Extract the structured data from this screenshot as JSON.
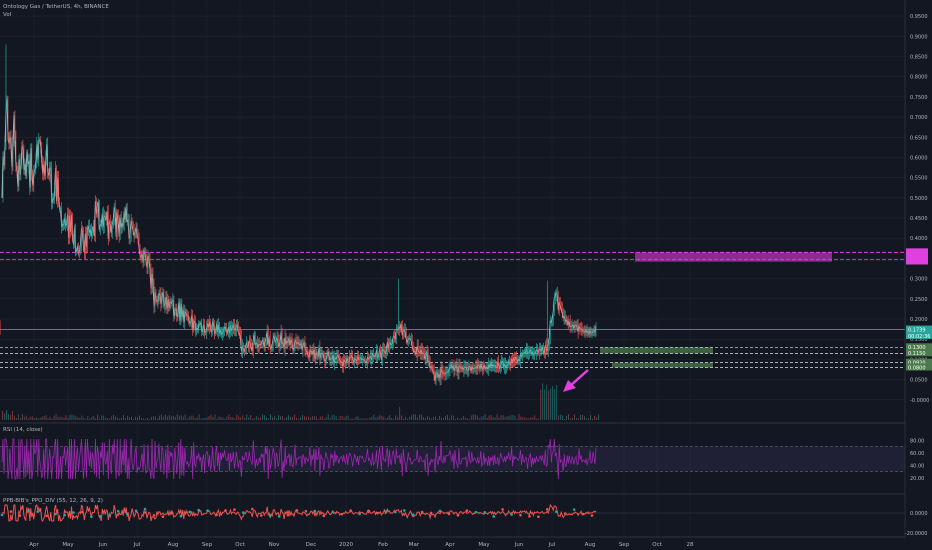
{
  "header": {
    "symbol_line": "Ontology Gas / TetherUS, 4h, BINANCE",
    "vol_label": "Vol"
  },
  "chart_data": {
    "type": "line",
    "title": "Ontology Gas / TetherUS, 4h, BINANCE",
    "xlabel": "",
    "ylabel": "",
    "x_ticks": [
      "Apr",
      "May",
      "Jun",
      "Jul",
      "Aug",
      "Sep",
      "Oct",
      "Nov",
      "Dec",
      "2020",
      "Feb",
      "Mar",
      "Apr",
      "May",
      "Jun",
      "Jul",
      "Aug",
      "Sep",
      "Oct",
      "28"
    ],
    "ylim": [
      -0.05,
      0.975
    ],
    "y_ticks": [
      "0.9500",
      "0.9000",
      "0.8500",
      "0.8000",
      "0.7500",
      "0.7000",
      "0.6500",
      "0.6000",
      "0.5500",
      "0.5000",
      "0.4500",
      "0.4000",
      "0.3500",
      "0.3000",
      "0.2500",
      "0.2000",
      "0.1500",
      "0.1000",
      "0.0500",
      "-0.0000"
    ],
    "price_series": {
      "name": "",
      "x": [
        0,
        1,
        2,
        3,
        4,
        5,
        6,
        7,
        8,
        9,
        10,
        11,
        12,
        13,
        14,
        15,
        16,
        17,
        18,
        19,
        20,
        21,
        22,
        23,
        24,
        25,
        26,
        27,
        28,
        29,
        30,
        31,
        32,
        33,
        34,
        35,
        36,
        37,
        38,
        39,
        40,
        41,
        42,
        43,
        44,
        45,
        46,
        47,
        48,
        49,
        50,
        51,
        52,
        53,
        54,
        55,
        56,
        57,
        58,
        59,
        60,
        61,
        62,
        63,
        64,
        65,
        66,
        67,
        68,
        69,
        70,
        71,
        72,
        73,
        74,
        75,
        76,
        77,
        78,
        79,
        80,
        81,
        82,
        83,
        84,
        85,
        86,
        87,
        88,
        89,
        90,
        91,
        92,
        93,
        94,
        95,
        96,
        97,
        98,
        99,
        100,
        101,
        102,
        103,
        104,
        105,
        106,
        107,
        108,
        109,
        110,
        111,
        112,
        113,
        114,
        115,
        116,
        117,
        118,
        119,
        120,
        121,
        122,
        123,
        124,
        125,
        126,
        127,
        128,
        129,
        130,
        131,
        132,
        133,
        134,
        135,
        136,
        137,
        138,
        139,
        140,
        141,
        142,
        143,
        144,
        145,
        146,
        147,
        148,
        149,
        150,
        151,
        152,
        153,
        154,
        155,
        156,
        157,
        158,
        159,
        160,
        161,
        162,
        163,
        164,
        165,
        166,
        167,
        168,
        169,
        170,
        171,
        172,
        173,
        174,
        175,
        176,
        177,
        178,
        179,
        180,
        181,
        182,
        183,
        184,
        185,
        186,
        187,
        188,
        189,
        190,
        191,
        192,
        193,
        194,
        195,
        196,
        197,
        198,
        199,
        200,
        201,
        202,
        203,
        204,
        205,
        206,
        207,
        208,
        209,
        210,
        211,
        212,
        213,
        214,
        215,
        216,
        217,
        218,
        219,
        220,
        221,
        222,
        223,
        224,
        225,
        226,
        227,
        228,
        229,
        230,
        231,
        232,
        233,
        234,
        235,
        236,
        237,
        238,
        239,
        240,
        241,
        242,
        243,
        244,
        245,
        246,
        247,
        248,
        249,
        250,
        251,
        252,
        253,
        254,
        255,
        256,
        257,
        258,
        259,
        260,
        261,
        262,
        263,
        264,
        265,
        266,
        267,
        268,
        269,
        270,
        271,
        272,
        273,
        274,
        275,
        276,
        277,
        278,
        279,
        280,
        281,
        282,
        283,
        284,
        285,
        286,
        287,
        288,
        289,
        290,
        291,
        292,
        293,
        294,
        295,
        296,
        297,
        298,
        299,
        300,
        301,
        302,
        303,
        304,
        305,
        306,
        307,
        308,
        309,
        310,
        311,
        312,
        313,
        314,
        315,
        316,
        317,
        318,
        319,
        320,
        321,
        322,
        323,
        324,
        325,
        326,
        327,
        328,
        329,
        330,
        331,
        332,
        333,
        334,
        335,
        336,
        337,
        338,
        339,
        340,
        341,
        342,
        343,
        344,
        345,
        346,
        347,
        348,
        349,
        350,
        351,
        352,
        353,
        354,
        355,
        356,
        357,
        358,
        359,
        360,
        361,
        362,
        363,
        364,
        365,
        366,
        367,
        368,
        369,
        370,
        371,
        372,
        373,
        374,
        375,
        376,
        377,
        378,
        379,
        380,
        381,
        382,
        383,
        384,
        385,
        386,
        387,
        388,
        389,
        390,
        391,
        392,
        393,
        394,
        395,
        396,
        397,
        398,
        399,
        400,
        401,
        402,
        403,
        404,
        405,
        406,
        407,
        408,
        409,
        410,
        411,
        412,
        413,
        414,
        415,
        416,
        417,
        418,
        419,
        420,
        421,
        422,
        423,
        424,
        425,
        426,
        427,
        428,
        429,
        430,
        431,
        432,
        433,
        434,
        435,
        436,
        437,
        438,
        439,
        440,
        441,
        442,
        443,
        444,
        445,
        446,
        447,
        448,
        449,
        450,
        451,
        452,
        453,
        454,
        455,
        456,
        457,
        458,
        459,
        460,
        461,
        462,
        463,
        464,
        465,
        466,
        467,
        468,
        469,
        470,
        471,
        472,
        473,
        474,
        475,
        476,
        477,
        478,
        479,
        480,
        481,
        482,
        483,
        484,
        485,
        486,
        487,
        488,
        489,
        490,
        491,
        492,
        493,
        494,
        495,
        496,
        497,
        498,
        499,
        500,
        501,
        502,
        503,
        504,
        505,
        506,
        507,
        508,
        509,
        510,
        511,
        512,
        513,
        514,
        515,
        516,
        517,
        518,
        519,
        520,
        521,
        522,
        523,
        524,
        525,
        526,
        527,
        528,
        529,
        530,
        531,
        532,
        533,
        534,
        535,
        536,
        537,
        538,
        539,
        540,
        541,
        542,
        543,
        544,
        545,
        546,
        547,
        548,
        549,
        550,
        551,
        552,
        553,
        554,
        555,
        556,
        557,
        558,
        559,
        560,
        561,
        562,
        563,
        564,
        565,
        566,
        567,
        568,
        569,
        570,
        571,
        572,
        573,
        574,
        575,
        576,
        577,
        578,
        579,
        580,
        581,
        582,
        583,
        584,
        585,
        586,
        587,
        588,
        589,
        590,
        591,
        592,
        593,
        594,
        595,
        596,
        597,
        598
      ],
      "values": [
        0.5,
        0.603,
        0.58,
        0.63,
        0.718,
        0.746,
        0.647,
        0.634,
        0.652,
        0.632,
        0.576,
        0.635,
        0.705,
        0.652,
        0.579,
        0.567,
        0.527,
        0.596,
        0.558,
        0.582,
        0.628,
        0.621,
        0.568,
        0.585,
        0.553,
        0.613,
        0.583,
        0.592,
        0.525,
        0.624,
        0.556,
        0.53,
        0.565,
        0.571,
        0.591,
        0.633,
        0.595,
        0.643,
        0.643,
        0.628,
        0.589,
        0.56,
        0.583,
        0.555,
        0.594,
        0.633,
        0.564,
        0.555,
        0.574,
        0.574,
        0.487,
        0.498,
        0.497,
        0.52,
        0.574,
        0.491,
        0.551,
        0.493,
        0.473,
        0.473,
        0.428,
        0.434,
        0.433,
        0.449,
        0.432,
        0.435,
        0.459,
        0.401,
        0.456,
        0.416,
        0.457,
        0.399,
        0.384,
        0.426,
        0.366,
        0.368,
        0.381,
        0.363,
        0.369,
        0.384,
        0.425,
        0.416,
        0.377,
        0.366,
        0.412,
        0.378,
        0.42,
        0.43,
        0.415,
        0.422,
        0.406,
        0.423,
        0.429,
        0.405,
        0.492,
        0.46,
        0.482,
        0.489,
        0.421,
        0.433,
        0.432,
        0.461,
        0.428,
        0.455,
        0.453,
        0.445,
        0.467,
        0.398,
        0.441,
        0.434,
        0.412,
        0.434,
        0.44,
        0.478,
        0.466,
        0.403,
        0.464,
        0.442,
        0.404,
        0.451,
        0.426,
        0.438,
        0.428,
        0.467,
        0.446,
        0.479,
        0.44,
        0.446,
        0.399,
        0.407,
        0.444,
        0.432,
        0.419,
        0.406,
        0.413,
        0.428,
        0.408,
        0.4,
        0.375,
        0.358,
        0.352,
        0.361,
        0.339,
        0.368,
        0.363,
        0.344,
        0.327,
        0.356,
        0.346,
        0.321,
        0.276,
        0.312,
        0.283,
        0.231,
        0.266,
        0.246,
        0.244,
        0.244,
        0.264,
        0.26,
        0.237,
        0.257,
        0.267,
        0.232,
        0.237,
        0.255,
        0.226,
        0.249,
        0.227,
        0.242,
        0.239,
        0.244,
        0.246,
        0.206,
        0.222,
        0.225,
        0.205,
        0.214,
        0.242,
        0.195,
        0.238,
        0.205,
        0.223,
        0.192,
        0.218,
        0.213,
        0.208,
        0.208,
        0.196,
        0.19,
        0.191,
        0.209,
        0.172,
        0.195,
        0.191,
        0.172,
        0.178,
        0.173,
        0.188,
        0.186,
        0.19,
        0.168,
        0.174,
        0.186,
        0.166,
        0.168,
        0.178,
        0.189,
        0.18,
        0.192,
        0.175,
        0.167,
        0.194,
        0.184,
        0.164,
        0.168,
        0.188,
        0.168,
        0.186,
        0.165,
        0.171,
        0.162,
        0.165,
        0.17,
        0.179,
        0.179,
        0.169,
        0.167,
        0.18,
        0.165,
        0.184,
        0.171,
        0.178,
        0.185,
        0.174,
        0.172,
        0.183,
        0.185,
        0.168,
        0.165,
        0.158,
        0.121,
        0.132,
        0.124,
        0.12,
        0.128,
        0.141,
        0.135,
        0.13,
        0.145,
        0.14,
        0.13,
        0.121,
        0.148,
        0.16,
        0.136,
        0.141,
        0.137,
        0.131,
        0.138,
        0.136,
        0.138,
        0.144,
        0.148,
        0.127,
        0.144,
        0.152,
        0.17,
        0.136,
        0.153,
        0.131,
        0.126,
        0.134,
        0.152,
        0.159,
        0.142,
        0.146,
        0.153,
        0.144,
        0.13,
        0.141,
        0.169,
        0.14,
        0.142,
        0.126,
        0.155,
        0.137,
        0.145,
        0.142,
        0.152,
        0.136,
        0.149,
        0.142,
        0.123,
        0.127,
        0.148,
        0.143,
        0.139,
        0.142,
        0.139,
        0.135,
        0.141,
        0.123,
        0.136,
        0.141,
        0.126,
        0.121,
        0.119,
        0.109,
        0.106,
        0.124,
        0.117,
        0.12,
        0.112,
        0.124,
        0.101,
        0.116,
        0.11,
        0.108,
        0.129,
        0.104,
        0.115,
        0.113,
        0.114,
        0.102,
        0.095,
        0.1,
        0.11,
        0.119,
        0.107,
        0.099,
        0.102,
        0.101,
        0.111,
        0.091,
        0.104,
        0.101,
        0.107,
        0.11,
        0.104,
        0.097,
        0.094,
        0.092,
        0.083,
        0.098,
        0.095,
        0.091,
        0.103,
        0.095,
        0.093,
        0.106,
        0.105,
        0.11,
        0.099,
        0.092,
        0.102,
        0.099,
        0.096,
        0.107,
        0.1,
        0.101,
        0.104,
        0.099,
        0.101,
        0.099,
        0.096,
        0.093,
        0.093,
        0.105,
        0.101,
        0.105,
        0.107,
        0.099,
        0.113,
        0.109,
        0.107,
        0.108,
        0.123,
        0.105,
        0.107,
        0.123,
        0.118,
        0.098,
        0.125,
        0.123,
        0.12,
        0.116,
        0.121,
        0.143,
        0.127,
        0.141,
        0.141,
        0.136,
        0.139,
        0.158,
        0.156,
        0.151,
        0.174,
        0.175,
        0.173,
        0.18,
        0.177,
        0.187,
        0.159,
        0.172,
        0.173,
        0.167,
        0.151,
        0.142,
        0.149,
        0.152,
        0.152,
        0.148,
        0.134,
        0.126,
        0.118,
        0.12,
        0.113,
        0.132,
        0.123,
        0.119,
        0.116,
        0.123,
        0.116,
        0.116,
        0.115,
        0.1,
        0.107,
        0.12,
        0.095,
        0.096,
        0.08,
        0.083,
        0.078,
        0.071,
        0.065,
        0.046,
        0.066,
        0.067,
        0.056,
        0.063,
        0.054,
        0.078,
        0.069,
        0.066,
        0.065,
        0.064,
        0.067,
        0.068,
        0.069,
        0.074,
        0.082,
        0.087,
        0.08,
        0.084,
        0.072,
        0.081,
        0.086,
        0.076,
        0.068,
        0.084,
        0.083,
        0.078,
        0.079,
        0.074,
        0.08,
        0.081,
        0.081,
        0.073,
        0.073,
        0.083,
        0.081,
        0.072,
        0.082,
        0.076,
        0.078,
        0.078,
        0.082,
        0.078,
        0.087,
        0.084,
        0.077,
        0.089,
        0.077,
        0.075,
        0.086,
        0.079,
        0.077,
        0.081,
        0.076,
        0.087,
        0.081,
        0.09,
        0.083,
        0.087,
        0.083,
        0.085,
        0.082,
        0.081,
        0.092,
        0.084,
        0.077,
        0.087,
        0.094,
        0.095,
        0.082,
        0.087,
        0.08,
        0.084,
        0.085,
        0.095,
        0.089,
        0.087,
        0.102,
        0.092,
        0.103,
        0.097,
        0.105,
        0.103,
        0.095,
        0.1,
        0.097,
        0.112,
        0.107,
        0.113,
        0.115,
        0.117,
        0.117,
        0.126,
        0.115,
        0.116,
        0.117,
        0.124,
        0.116,
        0.118,
        0.111,
        0.116,
        0.116,
        0.123,
        0.122,
        0.117,
        0.124,
        0.125,
        0.121,
        0.13,
        0.121,
        0.113,
        0.135,
        0.128,
        0.12,
        0.137,
        0.151,
        0.195,
        0.191,
        0.199,
        0.219,
        0.254,
        0.254,
        0.265,
        0.262,
        0.221,
        0.242,
        0.234,
        0.225,
        0.219,
        0.203,
        0.207,
        0.201,
        0.193,
        0.197,
        0.185,
        0.194,
        0.182,
        0.182,
        0.182,
        0.185,
        0.178,
        0.184,
        0.185,
        0.182,
        0.169,
        0.181,
        0.177,
        0.176,
        0.173,
        0.17,
        0.17,
        0.167,
        0.173,
        0.167,
        0.17,
        0.163,
        0.172,
        0.165,
        0.165,
        0.17,
        0.172,
        0.167,
        0.182,
        0.178,
        0.175
      ]
    },
    "levels": [
      {
        "y": 0.365,
        "style": "magenta-dashed"
      },
      {
        "y": 0.347,
        "style": "magenta-dashed"
      },
      {
        "y": 0.1739,
        "style": "teal-solid"
      },
      {
        "y": 0.13,
        "style": "white-dashed"
      },
      {
        "y": 0.115,
        "style": "white-dashed"
      },
      {
        "y": 0.092,
        "style": "white-dashed"
      },
      {
        "y": 0.08,
        "style": "white-dashed"
      }
    ],
    "price_labels": [
      "0.1739",
      "00:02:36",
      "0.1300",
      "0.1150",
      "0.0920",
      "0.0800"
    ],
    "rsi": {
      "label": "RSI (14, close)",
      "ylim": [
        0,
        100
      ],
      "y_ticks": [
        "80.00",
        "60.00",
        "40.00",
        "20.00"
      ],
      "band": [
        30,
        70
      ]
    },
    "macd": {
      "label": "PPB-BIB's_PPO_DIV (55, 12, 26, 9, 2)",
      "y_ticks": [
        "0.0000",
        "-20.0000"
      ]
    }
  }
}
